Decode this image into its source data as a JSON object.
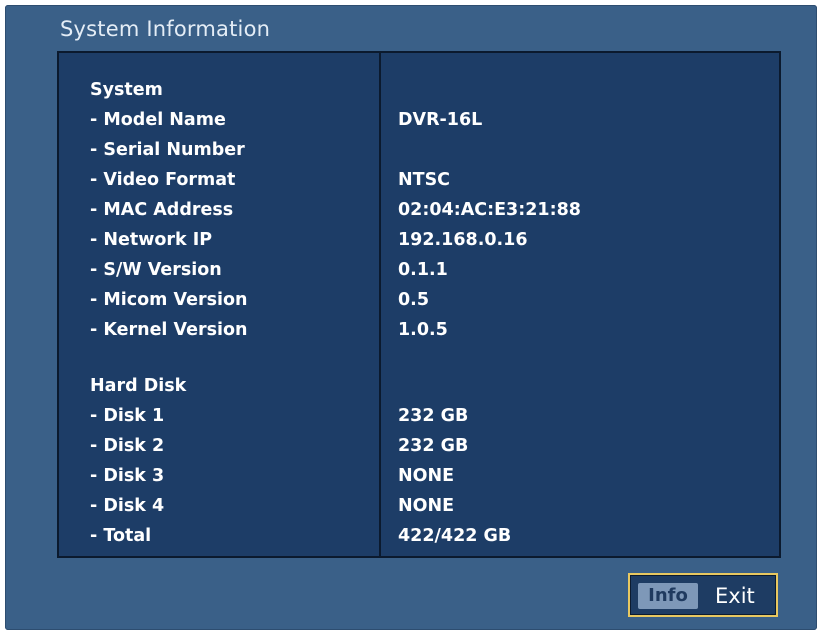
{
  "window": {
    "title": "System Information"
  },
  "system": {
    "heading": "System",
    "rows": [
      {
        "label": "- Model Name",
        "value": "DVR-16L"
      },
      {
        "label": "- Serial Number",
        "value": ""
      },
      {
        "label": "- Video Format",
        "value": "NTSC"
      },
      {
        "label": "- MAC Address",
        "value": "02:04:AC:E3:21:88"
      },
      {
        "label": "- Network IP",
        "value": "192.168.0.16"
      },
      {
        "label": "- S/W Version",
        "value": "0.1.1"
      },
      {
        "label": "- Micom Version",
        "value": "0.5"
      },
      {
        "label": "- Kernel Version",
        "value": "1.0.5"
      }
    ]
  },
  "hard_disk": {
    "heading": "Hard Disk",
    "rows": [
      {
        "label": "- Disk 1",
        "value": "232 GB"
      },
      {
        "label": "- Disk 2",
        "value": "232 GB"
      },
      {
        "label": "- Disk 3",
        "value": "NONE"
      },
      {
        "label": "- Disk 4",
        "value": "NONE"
      },
      {
        "label": "- Total",
        "value": "422/422 GB"
      }
    ]
  },
  "buttons": {
    "info_label": "Info",
    "exit_label": "Exit"
  },
  "colors": {
    "window_bg": "#3a6088",
    "panel_bg": "#1d3d67",
    "accent_border": "#e8c860"
  }
}
